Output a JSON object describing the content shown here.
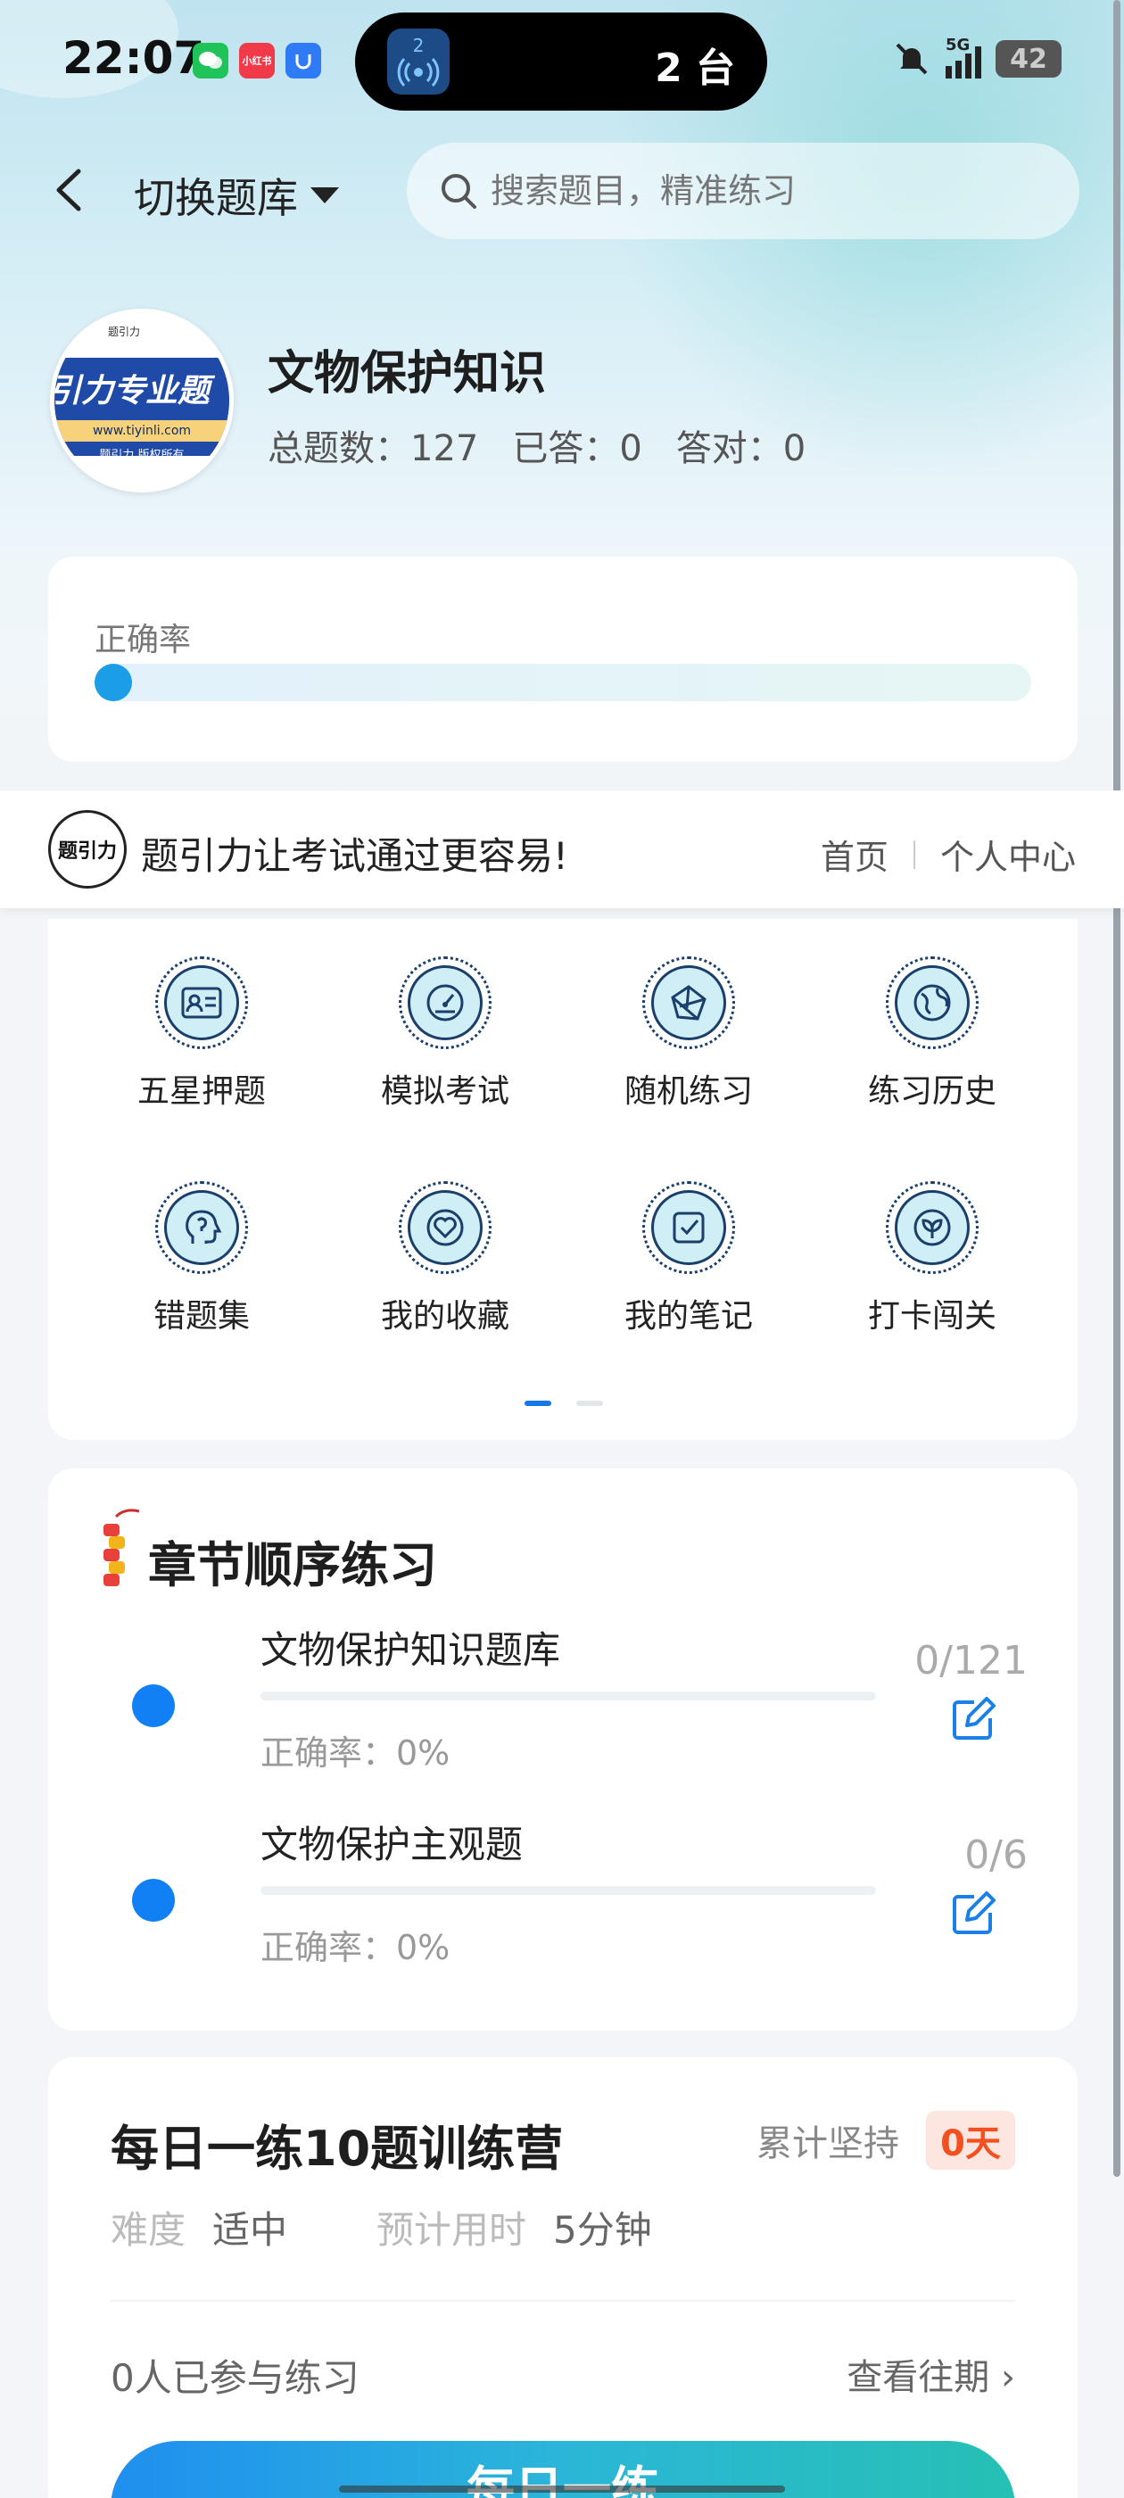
{
  "status_bar": {
    "time": "22:07",
    "apps": [
      "wechat",
      "xiaohongshu",
      "app-blue"
    ],
    "xiaohongshu_label": "小红书",
    "pill_badge": "2",
    "pill_text": "2 台",
    "network": "5G",
    "battery": "42"
  },
  "header": {
    "switch_label": "切换题库",
    "search_placeholder": "搜索题目，精准练习"
  },
  "bank": {
    "logo_text": "引力专业题",
    "logo_url": "www.tiyinli.com",
    "logo_copyright": "题引力 版权所有",
    "logo_top": "题引力",
    "title": "文物保护知识",
    "total": "总题数：127",
    "answered": "已答：0",
    "correct": "答对：0"
  },
  "accuracy": {
    "label": "正确率",
    "value": 0
  },
  "promo": {
    "logo_text": "题引力",
    "text": "题引力让考试通过更容易!",
    "link_home": "首页",
    "link_profile": "个人中心"
  },
  "features": [
    {
      "label": "五星押题",
      "icon": "id-card-icon"
    },
    {
      "label": "模拟考试",
      "icon": "gauge-icon"
    },
    {
      "label": "随机练习",
      "icon": "shuffle-icon"
    },
    {
      "label": "练习历史",
      "icon": "globe-icon"
    },
    {
      "label": "错题集",
      "icon": "head-icon"
    },
    {
      "label": "我的收藏",
      "icon": "heart-icon"
    },
    {
      "label": "我的笔记",
      "icon": "check-note-icon"
    },
    {
      "label": "打卡闯关",
      "icon": "leaf-icon"
    }
  ],
  "pager": {
    "pages": 2,
    "active": 0
  },
  "chapters": {
    "title": "章节顺序练习",
    "items": [
      {
        "name": "文物保护知识题库",
        "accuracy": "正确率：0%",
        "count": "0/121"
      },
      {
        "name": "文物保护主观题",
        "accuracy": "正确率：0%",
        "count": "0/6"
      }
    ]
  },
  "daily": {
    "title": "每日一练10题训练营",
    "streak_label": "累计坚持",
    "streak_value": "0天",
    "difficulty_label": "难度",
    "difficulty_value": "适中",
    "time_label": "预计用时",
    "time_value": "5分钟",
    "participants": "0人已参与练习",
    "history_link": "查看往期 ›",
    "button_label": "每日一练"
  },
  "colors": {
    "accent": "#1180f5",
    "streak": "#f2501f",
    "progress_dot": "#1b9ee6"
  }
}
